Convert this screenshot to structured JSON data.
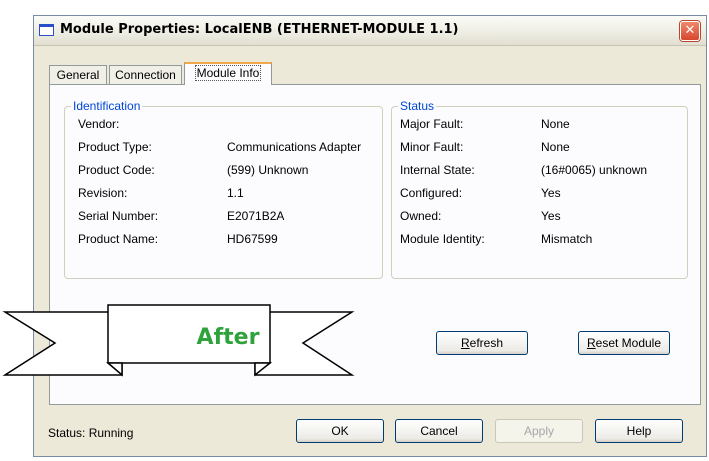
{
  "window": {
    "title": "Module Properties: LocalENB (ETHERNET-MODULE 1.1)",
    "close_glyph": "✕"
  },
  "tabs": [
    {
      "label": "General",
      "active": false
    },
    {
      "label": "Connection",
      "active": false
    },
    {
      "label": "Module Info",
      "active": true
    }
  ],
  "identification": {
    "title": "Identification",
    "rows": [
      {
        "label": "Vendor:",
        "value": ""
      },
      {
        "label": "Product Type:",
        "value": "Communications Adapter"
      },
      {
        "label": "Product Code:",
        "value": "(599) Unknown"
      },
      {
        "label": "Revision:",
        "value": "1.1"
      },
      {
        "label": "Serial Number:",
        "value": "E2071B2A"
      },
      {
        "label": "Product Name:",
        "value": "HD67599"
      }
    ]
  },
  "status_group": {
    "title": "Status",
    "rows": [
      {
        "label": "Major Fault:",
        "value": "None"
      },
      {
        "label": "Minor Fault:",
        "value": "None"
      },
      {
        "label": "Internal State:",
        "value": "(16#0065) unknown"
      },
      {
        "label": "Configured:",
        "value": "Yes"
      },
      {
        "label": "Owned:",
        "value": "Yes"
      },
      {
        "label": "Module Identity:",
        "value": "Mismatch"
      }
    ]
  },
  "actions": {
    "refresh": {
      "label": "Refresh",
      "mnemonic": "R"
    },
    "reset_module": {
      "label": "Reset Module",
      "mnemonic": "R"
    }
  },
  "banner": {
    "text": "After",
    "color": "#2fa23c"
  },
  "footer": {
    "status_label": "Status:",
    "status_value": "Running",
    "ok": "OK",
    "cancel": "Cancel",
    "apply": "Apply",
    "help": "Help"
  }
}
